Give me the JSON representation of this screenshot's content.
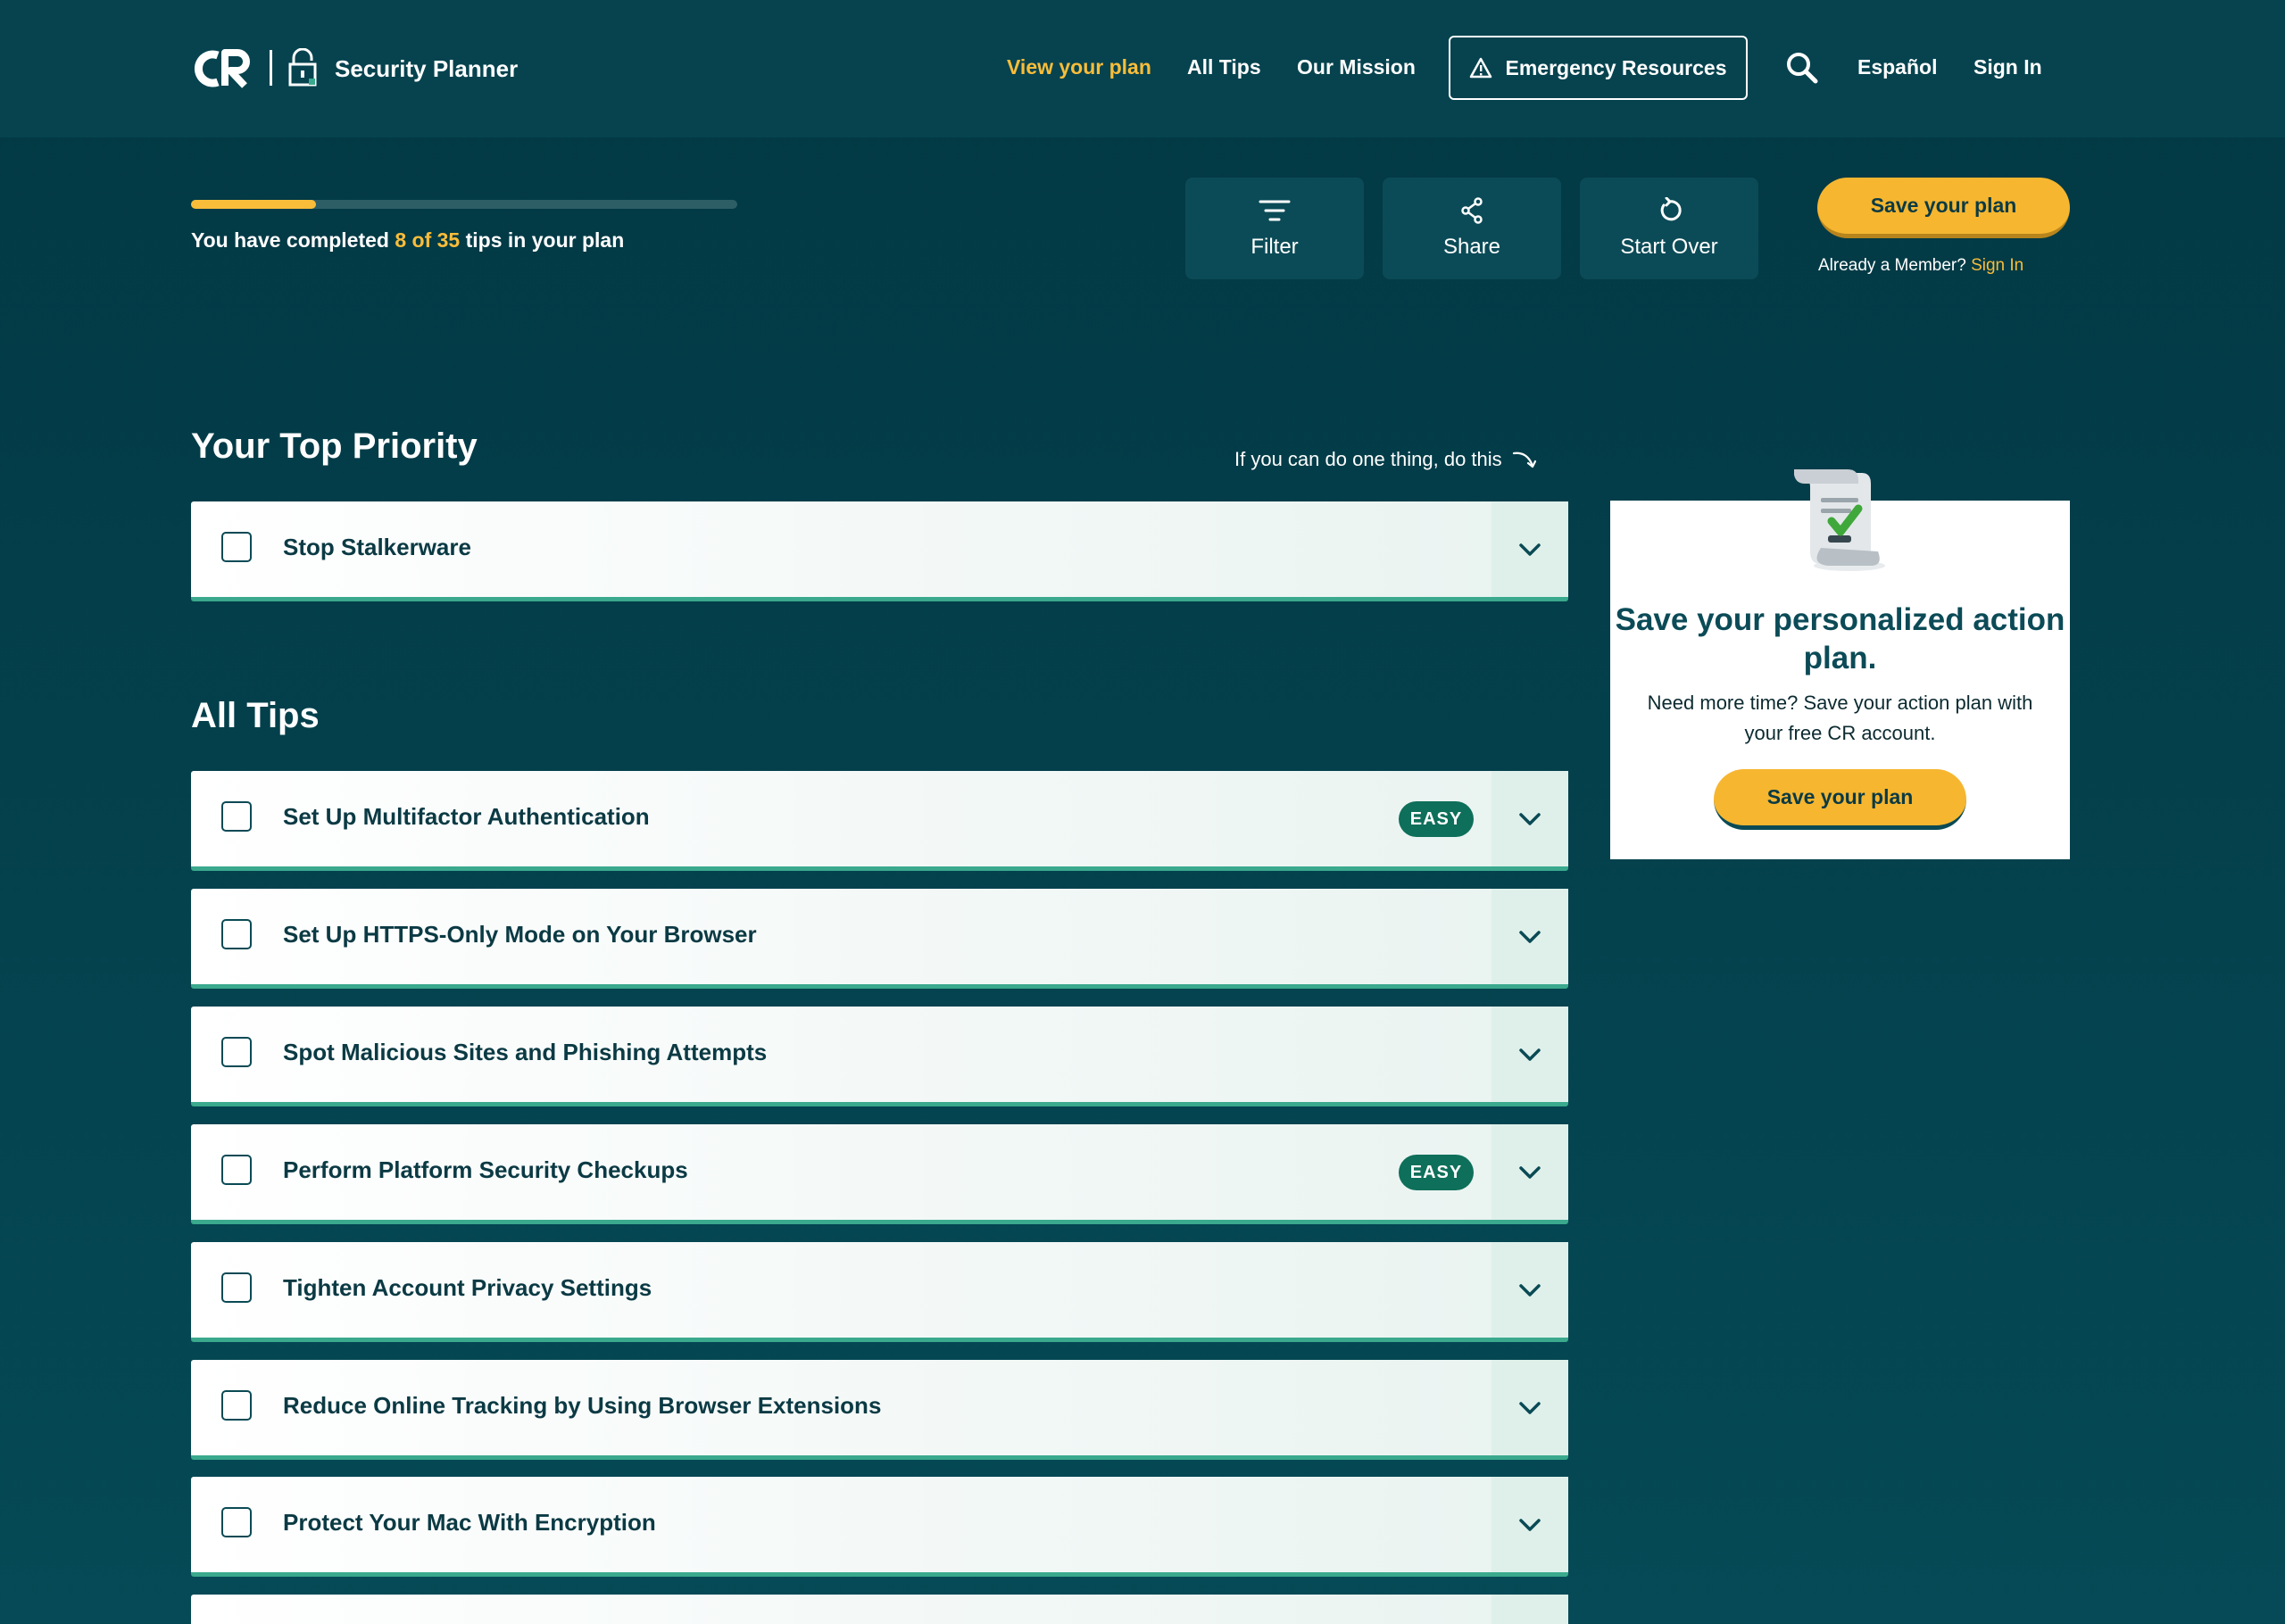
{
  "header": {
    "brand_logo": "CR",
    "brand_name": "Security Planner",
    "nav": {
      "view_plan": "View your plan",
      "all_tips": "All Tips",
      "our_mission": "Our Mission",
      "emergency": "Emergency Resources",
      "language": "Español",
      "sign_in": "Sign In"
    }
  },
  "plan_bar": {
    "progress": {
      "completed": 8,
      "total": 35,
      "fraction": 0.2286
    },
    "progress_text_before": "You have completed ",
    "progress_text_highlight": "8 of 35",
    "progress_text_after": " tips in your plan",
    "tools": {
      "filter": "Filter",
      "share": "Share",
      "start_over": "Start Over"
    },
    "save_label": "Save your plan",
    "member_prompt": "Already a Member? ",
    "member_sign_in": "Sign In"
  },
  "top_priority": {
    "title": "Your Top Priority",
    "hint": "If you can do one thing, do this",
    "tip": {
      "title": "Stop Stalkerware"
    }
  },
  "all_tips": {
    "title": "All Tips",
    "items": [
      {
        "title": "Set Up Multifactor Authentication",
        "badge": "EASY"
      },
      {
        "title": "Set Up HTTPS-Only Mode on Your Browser",
        "badge": ""
      },
      {
        "title": "Spot Malicious Sites and Phishing Attempts",
        "badge": ""
      },
      {
        "title": "Perform Platform Security Checkups",
        "badge": "EASY"
      },
      {
        "title": "Tighten Account Privacy Settings",
        "badge": ""
      },
      {
        "title": "Reduce Online Tracking by Using Browser Extensions",
        "badge": ""
      },
      {
        "title": "Protect Your Mac With Encryption",
        "badge": ""
      },
      {
        "title": "",
        "badge": ""
      }
    ]
  },
  "side_panel": {
    "heading": "Save your personalized action plan.",
    "body": "Need more time? Save your action plan with your free CR account.",
    "save_label": "Save your plan"
  },
  "colors": {
    "accent": "#f9bd3a",
    "background": "#023843",
    "header_bg": "#06434f",
    "card_border": "#3aa98d",
    "badge_bg": "#0e6f5a"
  },
  "icons": {
    "warning": "warning-triangle-icon",
    "search": "search-icon",
    "filter": "filter-icon",
    "share": "share-icon",
    "start_over": "refresh-icon",
    "expand": "chevron-down-icon",
    "hint_arrow": "curved-arrow-icon"
  }
}
